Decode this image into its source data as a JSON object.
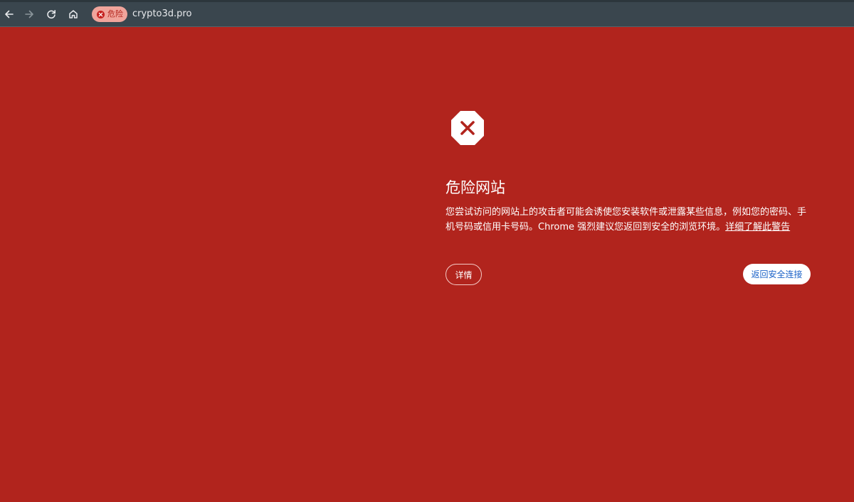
{
  "toolbar": {
    "back_icon": "arrow-left-icon",
    "forward_icon": "arrow-right-icon",
    "reload_icon": "reload-icon",
    "home_icon": "home-icon"
  },
  "omnibox": {
    "security_chip_label": "危险",
    "security_chip_icon": "close-circle-icon",
    "url": "crypto3d.pro"
  },
  "interstitial": {
    "icon": "stop-sign-x-icon",
    "heading": "危险网站",
    "message": "您尝试访问的网站上的攻击者可能会诱使您安装软件或泄露某些信息，例如您的密码、手机号码或信用卡号码。Chrome 强烈建议您返回到安全的浏览环境。",
    "learn_more_link": "详细了解此警告",
    "details_button": "详情",
    "back_to_safety_button": "返回安全连接"
  },
  "colors": {
    "page_background": "#b1241d",
    "toolbar_background": "#3a464e",
    "chip_background": "#f0a49b",
    "chip_text": "#b3261e",
    "primary_button_text": "#1a61c7"
  }
}
